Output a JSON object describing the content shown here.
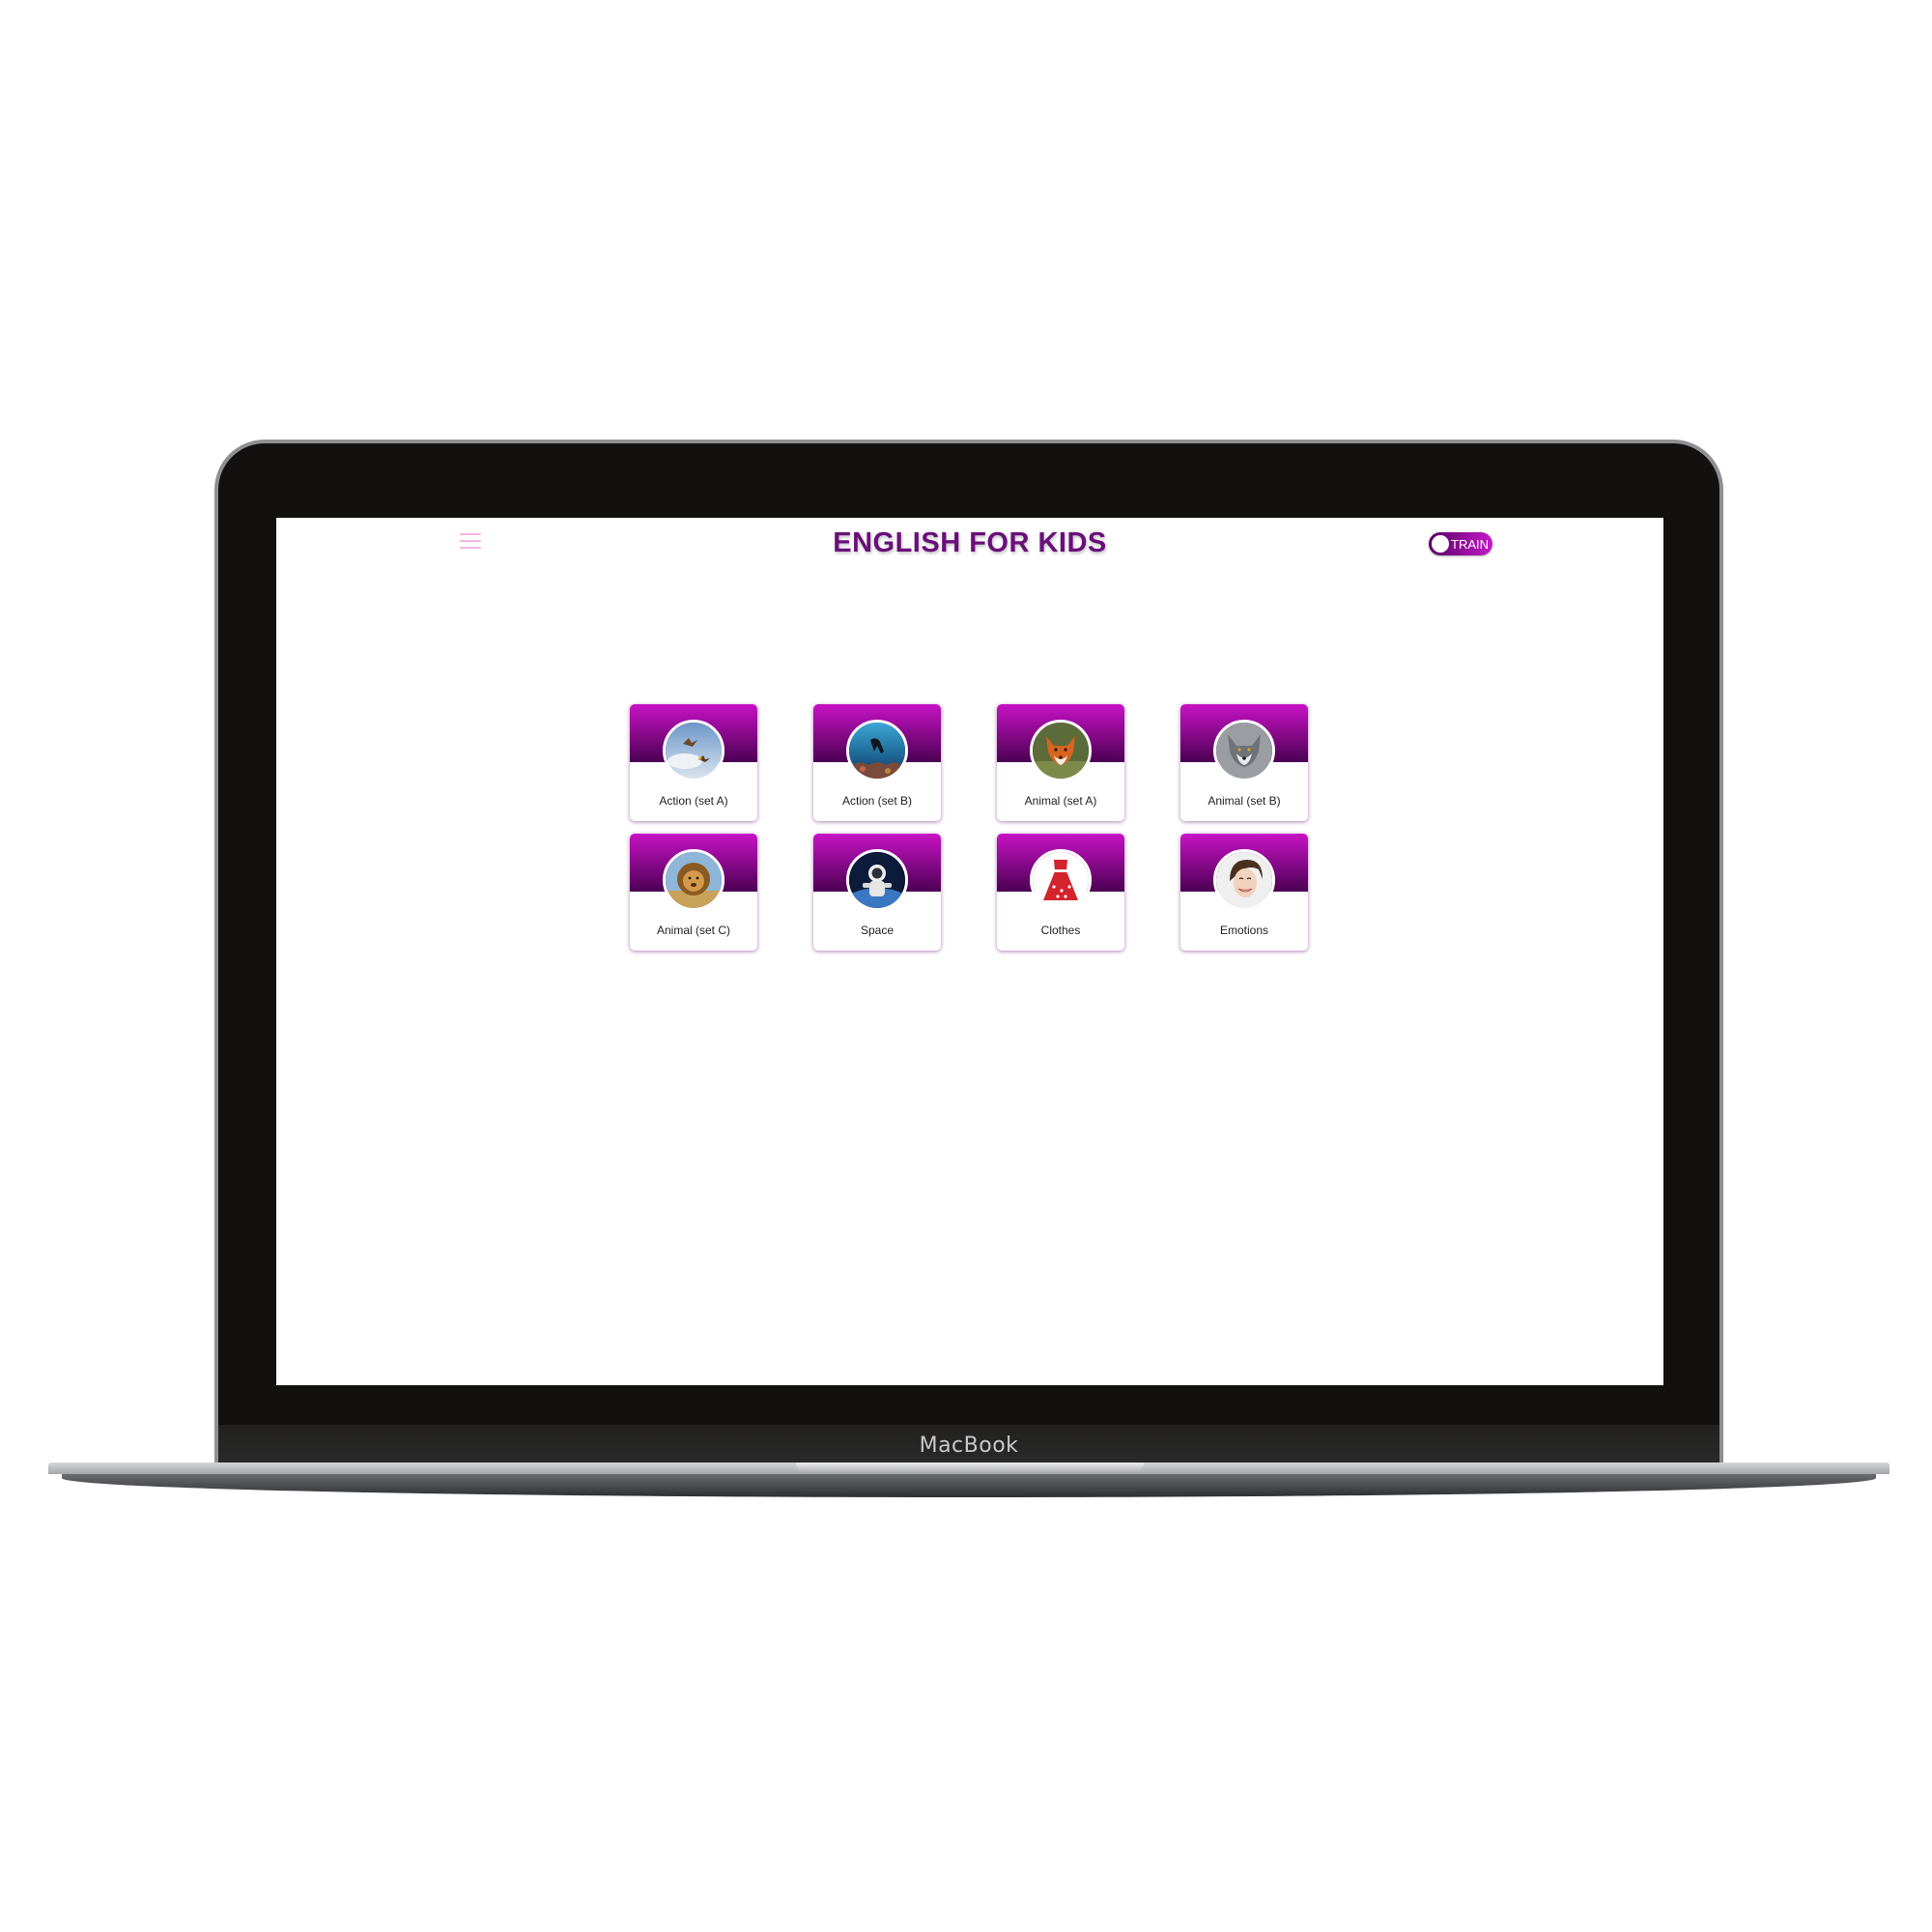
{
  "device": {
    "brand_label": "MacBook"
  },
  "app": {
    "title": "ENGLISH FOR KIDS",
    "mode_toggle": {
      "label": "TRAIN",
      "on": false
    },
    "accent_colors": {
      "title": "#6a0f7a",
      "card_gradient_top": "#c812c5",
      "card_gradient_bottom": "#4a0052",
      "menu_icon": "#f2b6e6"
    }
  },
  "categories": [
    {
      "label": "Action (set A)",
      "icon": "birds-in-sky-image"
    },
    {
      "label": "Action (set B)",
      "icon": "diver-underwater-image"
    },
    {
      "label": "Animal (set A)",
      "icon": "fox-image"
    },
    {
      "label": "Animal (set B)",
      "icon": "wolf-image"
    },
    {
      "label": "Animal (set C)",
      "icon": "lion-image"
    },
    {
      "label": "Space",
      "icon": "astronaut-image"
    },
    {
      "label": "Clothes",
      "icon": "red-dress-image"
    },
    {
      "label": "Emotions",
      "icon": "smiling-woman-image"
    }
  ]
}
